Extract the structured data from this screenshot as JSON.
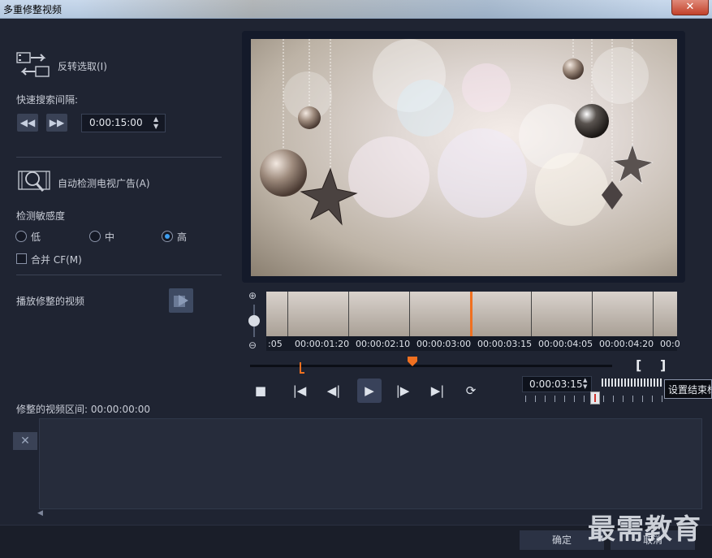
{
  "window": {
    "title": "多重修整视频",
    "close_glyph": "✕"
  },
  "left": {
    "invert_selection": "反转选取(I)",
    "quick_search_label": "快速搜索间隔:",
    "quick_search_value": "0:00:15:00",
    "auto_detect": "自动检测电视广告(A)",
    "sensitivity_label": "检测敏感度",
    "sensitivity_options": [
      "低",
      "中",
      "高"
    ],
    "sensitivity_selected": "高",
    "merge_cf": "合并 CF(M)",
    "play_trimmed": "播放修整的视频"
  },
  "timeline": {
    "timecodes": [
      ":05",
      "00:00:01:20",
      "00:00:02:10",
      "00:00:03:00",
      "00:00:03:15",
      "00:00:04:05",
      "00:00:04:20",
      "00:0"
    ],
    "current_time": "0:00:03:15",
    "tooltip": "设置结束标"
  },
  "trimmed_duration_label": "修整的视频区间: 00:00:00:00",
  "footer": {
    "ok": "确定",
    "cancel": "取消"
  },
  "watermark": "最需教育",
  "colors": {
    "accent_orange": "#f07020",
    "radio_on": "#3d9ef0"
  }
}
